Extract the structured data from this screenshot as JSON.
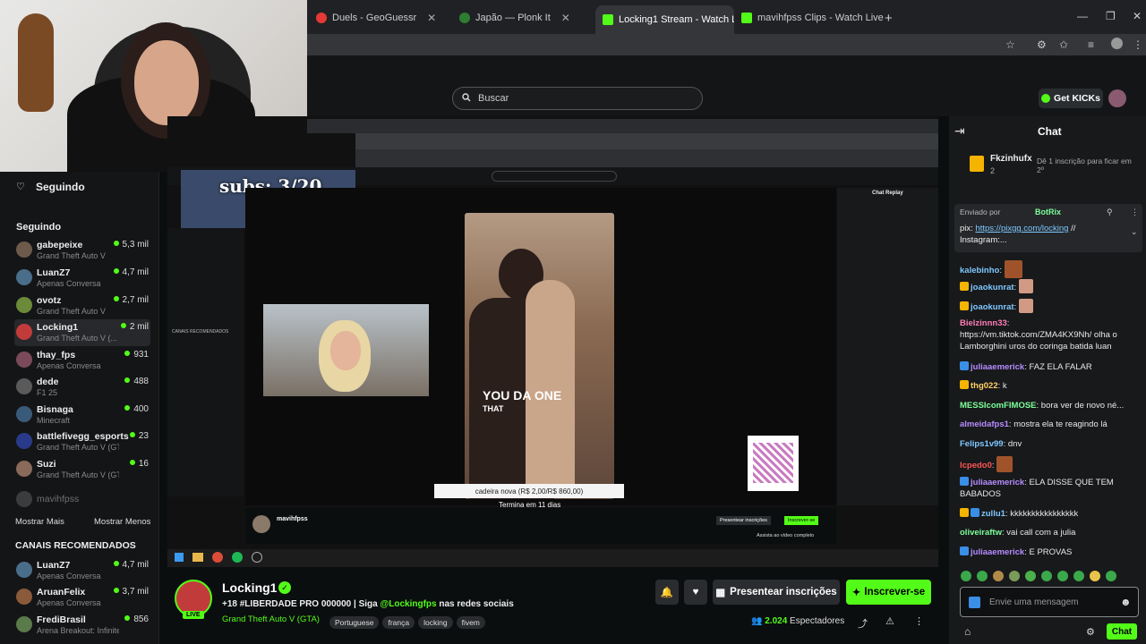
{
  "tabs": [
    {
      "label": "Duels - GeoGuessr",
      "color": "#e53935"
    },
    {
      "label": "Japão — Plonk It",
      "color": "#2e7d32"
    },
    {
      "label": "Locking1 Stream - Watch Li...",
      "color": "#53fc18"
    },
    {
      "label": "mavihfpss Clips - Watch Live o...",
      "color": "#53fc18"
    }
  ],
  "header": {
    "search_placeholder": "Buscar",
    "get_kicks": "Get KICKs"
  },
  "webcam_overlay": "subs: 3/20",
  "sidebar": {
    "following_title": "Seguindo",
    "following_label": "Seguindo",
    "following": [
      {
        "name": "gabepeixe",
        "game": "Grand Theft Auto V",
        "viewers": "5,3 mil",
        "color": "#6d5a4a"
      },
      {
        "name": "LuanZ7",
        "game": "Apenas Conversa",
        "viewers": "4,7 mil",
        "color": "#4a6d8a"
      },
      {
        "name": "ovotz",
        "game": "Grand Theft Auto V",
        "viewers": "2,7 mil",
        "color": "#6b8a3a"
      },
      {
        "name": "Locking1",
        "game": "Grand Theft Auto V (...",
        "viewers": "2 mil",
        "color": "#c23b3b"
      },
      {
        "name": "thay_fps",
        "game": "Apenas Conversa",
        "viewers": "931",
        "color": "#7a4a5a"
      },
      {
        "name": "dede",
        "game": "F1 25",
        "viewers": "488",
        "color": "#5a5a5a"
      },
      {
        "name": "Bisnaga",
        "game": "Minecraft",
        "viewers": "400",
        "color": "#3a5a7a"
      },
      {
        "name": "battlefivegg_esports",
        "game": "Grand Theft Auto V (GTA)",
        "viewers": "23",
        "color": "#2a3a8a"
      },
      {
        "name": "Suzi",
        "game": "Grand Theft Auto V (GTA)",
        "viewers": "16",
        "color": "#8a6a5a"
      }
    ],
    "offline": "mavihfpss",
    "show_more": "Mostrar Mais",
    "show_less": "Mostrar Menos",
    "recommended_title": "CANAIS RECOMENDADOS",
    "recommended": [
      {
        "name": "LuanZ7",
        "game": "Apenas Conversa",
        "viewers": "4,7 mil",
        "color": "#4a6d8a"
      },
      {
        "name": "AruanFelix",
        "game": "Apenas Conversa",
        "viewers": "3,7 mil",
        "color": "#8a5a3a"
      },
      {
        "name": "FrediBrasil",
        "game": "Arena Breakout: Infinite",
        "viewers": "856",
        "color": "#5a7a4a"
      }
    ]
  },
  "video": {
    "overlay_big": "YOU DA ONE",
    "overlay_small": "THAT",
    "caption1": "cadeira nova (R$ 2,00/R$ 860,00)",
    "caption2": "Termina em 11 dias",
    "nested_streamer": "mavihfpss",
    "nested_present": "Presentear inscrições",
    "nested_subscribe": "Inscrever-se",
    "nested_full": "Assista ao vídeo completo",
    "nested_chat_title": "Chat Replay",
    "nested_recommended": "CANAIS RECOMENDADOS"
  },
  "stream": {
    "name": "Locking1",
    "live": "LIVE",
    "title_prefix": "+18 #LIBERDADE PRO 000000 | Siga",
    "handle": "@Lockingfps",
    "title_suffix": "nas redes sociais",
    "category": "Grand Theft Auto V (GTA)",
    "tags": [
      "Portuguese",
      "frança",
      "locking",
      "fivem"
    ],
    "present_label": "Presentear inscrições",
    "subscribe_label": "Inscrever-se",
    "viewers": "2.024",
    "viewers_label": "Espectadores"
  },
  "chat": {
    "title": "Chat",
    "top_user": "Fkzinhufx",
    "top_count": "2",
    "top_note": "Dê 1 inscrição para ficar em 2º",
    "pinned_by": "Enviado por",
    "pinned_user": "BotRix",
    "pinned_text1": "pix:",
    "pinned_link": "https://pixgg.com/locking",
    "pinned_text2": "//",
    "pinned_text3": "Instagram:...",
    "messages": [
      {
        "user": "kalebinho",
        "text": "",
        "color": "#7ec8ff"
      },
      {
        "user": "joaokunrat",
        "text": "",
        "color": "#7ec8ff"
      },
      {
        "user": "joaokunrat",
        "text": "",
        "color": "#7ec8ff"
      },
      {
        "user": "Bielzinnn33",
        "text": "https://vm.tiktok.com/ZMA4KX9Nh/ olha o Lamborghini uros do coringa batida luan",
        "color": "#ff7eb6"
      },
      {
        "user": "juliaaemerick",
        "text": "FAZ ELA FALAR",
        "color": "#b58cff"
      },
      {
        "user": "thg022",
        "text": "k",
        "color": "#ffd166"
      },
      {
        "user": "MESSIcomFIMOSE",
        "text": "bora ver de novo né...",
        "color": "#7dff9a"
      },
      {
        "user": "almeidafps1",
        "text": "mostra ela te reagindo lá",
        "color": "#b58cff"
      },
      {
        "user": "Felips1v99",
        "text": "dnv",
        "color": "#7ec8ff"
      },
      {
        "user": "lcpedo0",
        "text": "",
        "color": "#ff5555"
      },
      {
        "user": "juliaaemerick",
        "text": "ELA DISSE QUE TEM BABADOS",
        "color": "#b58cff"
      },
      {
        "user": "zullu1",
        "text": "kkkkkkkkkkkkkkkk",
        "color": "#7ec8ff"
      },
      {
        "user": "oliveiraftw",
        "text": "vai call com a julia",
        "color": "#7dff9a"
      },
      {
        "user": "juliaaemerick",
        "text": "E PROVAS",
        "color": "#b58cff"
      }
    ],
    "input_placeholder": "Envie uma mensagem",
    "send_label": "Chat"
  },
  "colors": {
    "accent": "#53fc18",
    "bg": "#0b0e0f"
  }
}
